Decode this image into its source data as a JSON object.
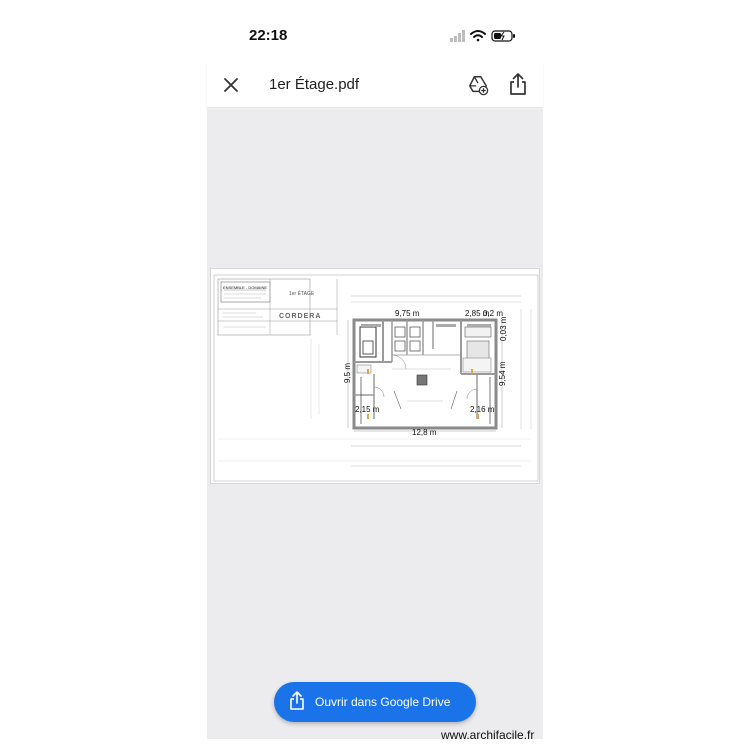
{
  "status_bar": {
    "time": "22:18"
  },
  "app_bar": {
    "title": "1er Étage.pdf"
  },
  "pdf": {
    "title_block": {
      "line1": "ENSEMBLE - DOMAINE",
      "stage": "1er ÉTAGE",
      "firm": "CORDERA"
    },
    "dimensions": {
      "top_width": "9,75 m",
      "top_right_a": "2,85 m",
      "top_right_b": "0,2 m",
      "right_small": "0,03 m",
      "left_height": "9,5 m",
      "right_height": "9,54 m",
      "left_inner": "2,15 m",
      "right_inner": "2,16 m",
      "bottom_width": "12,8 m"
    }
  },
  "fab": {
    "label": "Ouvrir dans Google Drive"
  },
  "watermark": "www.archifacile.fr",
  "colors": {
    "fab": "#1a73e8",
    "viewer_bg": "#ececef",
    "wall": "#8a8a8a"
  }
}
